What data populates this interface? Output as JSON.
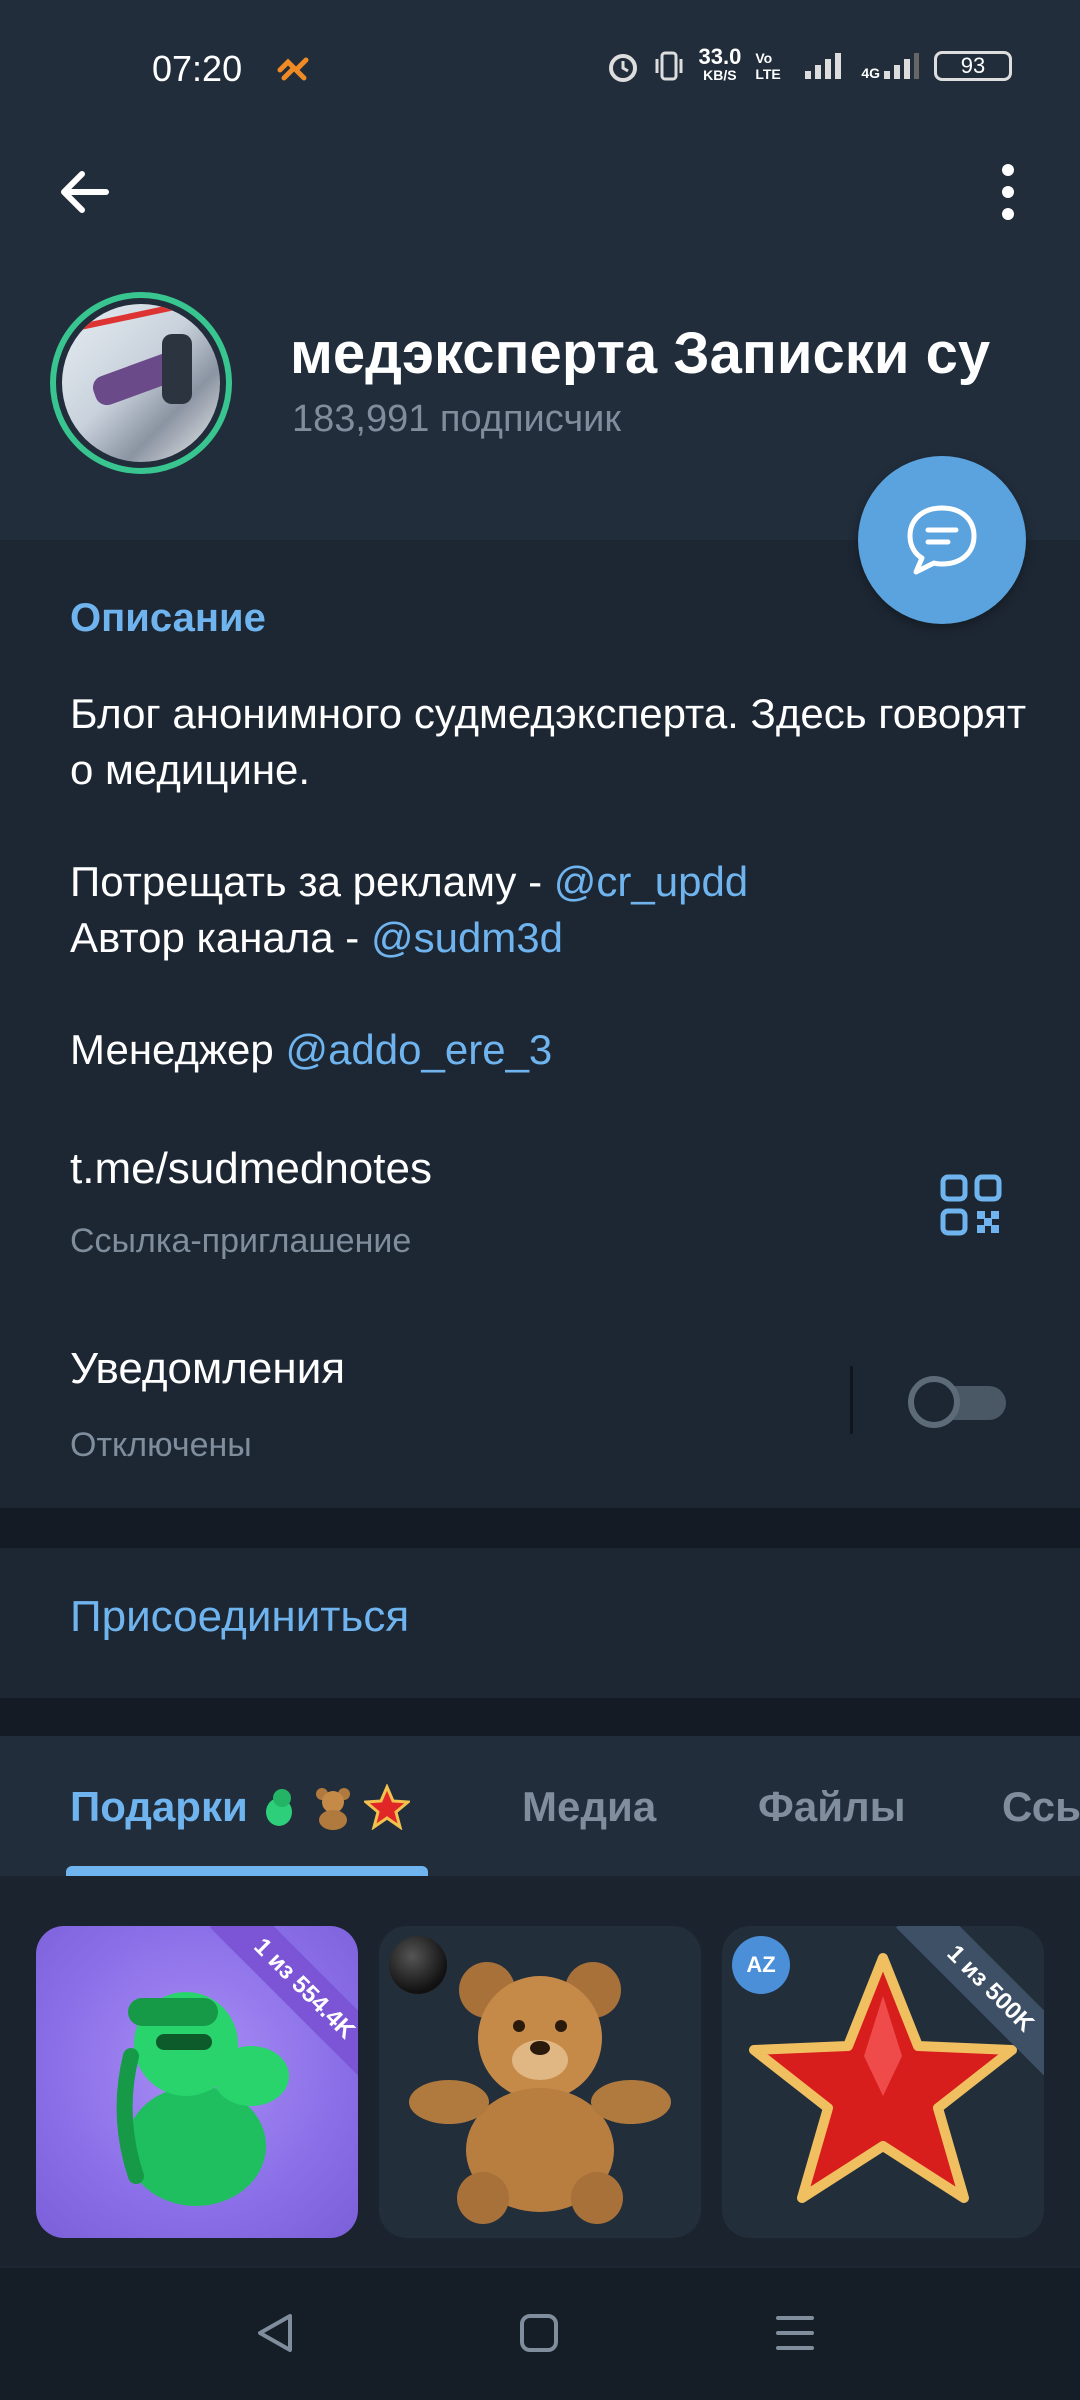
{
  "status_bar": {
    "time": "07:20",
    "net_speed_value": "33.0",
    "net_speed_unit": "KB/S",
    "volte": "Vo LTE",
    "network": "4G",
    "battery": "93"
  },
  "header": {
    "back_icon": "arrow-left-icon",
    "menu_icon": "more-vertical-icon",
    "title": "медэксперта   Записки су",
    "subscribers": "183,991 подписчик"
  },
  "fab_icon": "chat-bubble-icon",
  "info": {
    "description_label": "Описание",
    "description_line1": "Блог анонимного судмедэксперта. Здесь говорят о медицине.",
    "ads_prefix": "Потрещать за рекламу - ",
    "ads_mention": "@cr_updd",
    "author_prefix": "Автор канала - ",
    "author_mention": "@sudm3d",
    "manager_prefix": "Менеджер ",
    "manager_mention": "@addo_ere_3",
    "link": "t.me/sudmednotes",
    "link_caption": "Ссылка-приглашение",
    "notifications_label": "Уведомления",
    "notifications_state": "Отключены",
    "notifications_enabled": false
  },
  "join_label": "Присоединиться",
  "tabs": {
    "gifts": "Подарки",
    "media": "Медиа",
    "files": "Файлы",
    "links": "Ссь"
  },
  "gifts": [
    {
      "ribbon": "1 из 554.4K",
      "item": "green-dino-gift-icon"
    },
    {
      "item": "teddy-bear-gift-icon"
    },
    {
      "ribbon": "1 из 500K",
      "badge": "AZ",
      "item": "red-star-gift-icon"
    }
  ],
  "colors": {
    "accent": "#6fb4ee",
    "background": "#1d2733",
    "header": "#212d3b",
    "fab": "#5aa3df"
  }
}
